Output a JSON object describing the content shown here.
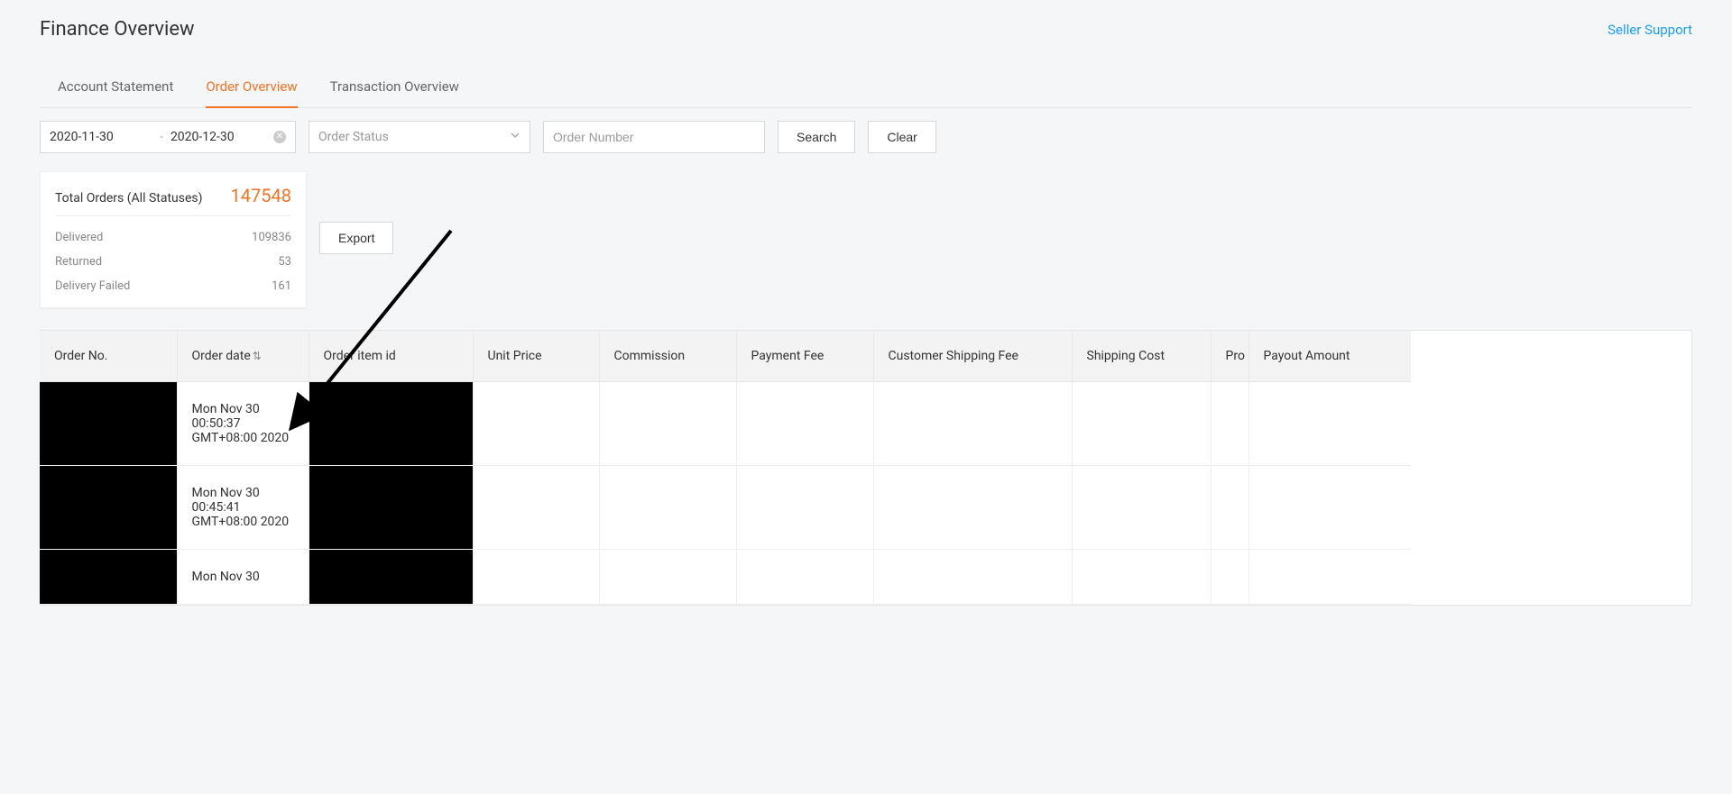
{
  "header": {
    "title": "Finance Overview",
    "support_link": "Seller Support"
  },
  "tabs": [
    {
      "label": "Account Statement",
      "active": false
    },
    {
      "label": "Order Overview",
      "active": true
    },
    {
      "label": "Transaction Overview",
      "active": false
    }
  ],
  "filters": {
    "date_from": "2020-11-30",
    "date_to": "2020-12-30",
    "status_placeholder": "Order Status",
    "order_number_placeholder": "Order Number",
    "search_label": "Search",
    "clear_label": "Clear"
  },
  "summary": {
    "total_label": "Total Orders (All Statuses)",
    "total_value": "147548",
    "rows": [
      {
        "label": "Delivered",
        "value": "109836"
      },
      {
        "label": "Returned",
        "value": "53"
      },
      {
        "label": "Delivery Failed",
        "value": "161"
      }
    ]
  },
  "export_label": "Export",
  "table": {
    "columns": [
      "Order No.",
      "Order date",
      "Order item id",
      "Unit Price",
      "Commission",
      "Payment Fee",
      "Customer Shipping Fee",
      "Shipping Cost",
      "Pro",
      "Payout Amount"
    ],
    "rows": [
      {
        "order_no": "",
        "order_date": "Mon Nov 30 00:50:37 GMT+08:00 2020",
        "order_item_id": "",
        "unit_price": "",
        "commission": "",
        "payment_fee": "",
        "cust_ship": "",
        "ship_cost": "",
        "pro": "",
        "payout": ""
      },
      {
        "order_no": "",
        "order_date": "Mon Nov 30 00:45:41 GMT+08:00 2020",
        "order_item_id": "",
        "unit_price": "",
        "commission": "",
        "payment_fee": "",
        "cust_ship": "",
        "ship_cost": "",
        "pro": "",
        "payout": ""
      },
      {
        "order_no": "",
        "order_date": "Mon Nov 30",
        "order_item_id": "",
        "unit_price": "",
        "commission": "",
        "payment_fee": "",
        "cust_ship": "",
        "ship_cost": "",
        "pro": "",
        "payout": ""
      }
    ]
  }
}
